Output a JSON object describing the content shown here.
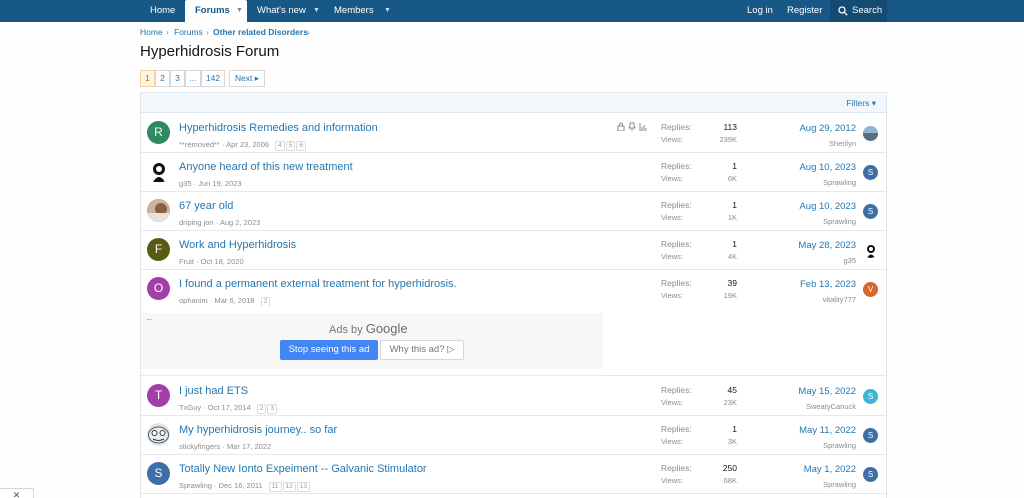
{
  "nav": {
    "home": "Home",
    "forums": "Forums",
    "whats_new": "What's new",
    "members": "Members",
    "login": "Log in",
    "register": "Register",
    "search": "Search"
  },
  "breadcrumb": [
    "Home",
    "Forums",
    "Other related Disorders"
  ],
  "page_title": "Hyperhidrosis Forum",
  "pager": {
    "pages": [
      "1",
      "2",
      "3",
      "…",
      "142"
    ],
    "next": "Next ▸"
  },
  "filters": "Filters ▾",
  "labels": {
    "replies": "Replies:",
    "views": "Views:"
  },
  "threads": [
    {
      "avatar": "R",
      "avatar_color": "#2e8a5f",
      "title": "Hyperhidrosis Remedies and information",
      "author": "**removed**",
      "date": "Apr 23, 2006",
      "pages": [
        "4",
        "5",
        "6"
      ],
      "replies": "113",
      "views": "239K",
      "last_date": "Aug 29, 2012",
      "last_user": "Sherilyn",
      "last_avatar": "",
      "last_avatar_color": "#7aa4c4",
      "has_icons": true
    },
    {
      "avatar": "",
      "avatar_color": "#ffffff",
      "title": "Anyone heard of this new treatment",
      "author": "g35",
      "date": "Jun 19, 2023",
      "pages": [],
      "replies": "1",
      "views": "6K",
      "last_date": "Aug 10, 2023",
      "last_user": "Sprawling",
      "last_avatar": "S",
      "last_avatar_color": "#3d6ea6",
      "has_icons": false
    },
    {
      "avatar": "",
      "avatar_color": "#b08a6a",
      "title": "67 year old",
      "author": "driping jon",
      "date": "Aug 2, 2023",
      "pages": [],
      "replies": "1",
      "views": "1K",
      "last_date": "Aug 10, 2023",
      "last_user": "Sprawling",
      "last_avatar": "S",
      "last_avatar_color": "#3d6ea6",
      "has_icons": false
    },
    {
      "avatar": "F",
      "avatar_color": "#5a5a12",
      "title": "Work and Hyperhidrosis",
      "author": "Fruit",
      "date": "Oct 18, 2020",
      "pages": [],
      "replies": "1",
      "views": "4K",
      "last_date": "May 28, 2023",
      "last_user": "g35",
      "last_avatar": "",
      "last_avatar_color": "#ffffff",
      "has_icons": false
    },
    {
      "avatar": "O",
      "avatar_color": "#a33ea8",
      "title": "I found a permanent external treatment for hyperhidrosis.",
      "author": "ophanim",
      "date": "Mar 6, 2018",
      "pages": [
        "2"
      ],
      "replies": "39",
      "views": "19K",
      "last_date": "Feb 13, 2023",
      "last_user": "vitality777",
      "last_avatar": "V",
      "last_avatar_color": "#d9662a",
      "has_icons": false
    },
    {
      "avatar": "T",
      "avatar_color": "#a33ea8",
      "title": "I just had ETS",
      "author": "TxGuy",
      "date": "Oct 17, 2014",
      "pages": [
        "2",
        "3"
      ],
      "replies": "45",
      "views": "23K",
      "last_date": "May 15, 2022",
      "last_user": "SweatyCanuck",
      "last_avatar": "S",
      "last_avatar_color": "#3fb2d6",
      "has_icons": false
    },
    {
      "avatar": "",
      "avatar_color": "#dbe6ee",
      "title": "My hyperhidrosis journey.. so far",
      "author": "stickyfingers",
      "date": "Mar 17, 2022",
      "pages": [],
      "replies": "1",
      "views": "3K",
      "last_date": "May 11, 2022",
      "last_user": "Sprawling",
      "last_avatar": "S",
      "last_avatar_color": "#3d6ea6",
      "has_icons": false
    },
    {
      "avatar": "S",
      "avatar_color": "#3d6ea6",
      "title": "Totally New Ionto Expeiment -- Galvanic Stimulator",
      "author": "Sprawling",
      "date": "Dec 16, 2011",
      "pages": [
        "11",
        "12",
        "13"
      ],
      "replies": "250",
      "views": "68K",
      "last_date": "May 1, 2022",
      "last_user": "Sprawling",
      "last_avatar": "S",
      "last_avatar_color": "#3d6ea6",
      "has_icons": false
    }
  ],
  "ad": {
    "ads_by": "Ads by",
    "google": "Google",
    "stop": "Stop seeing this ad",
    "why": "Why this ad? ▷"
  }
}
